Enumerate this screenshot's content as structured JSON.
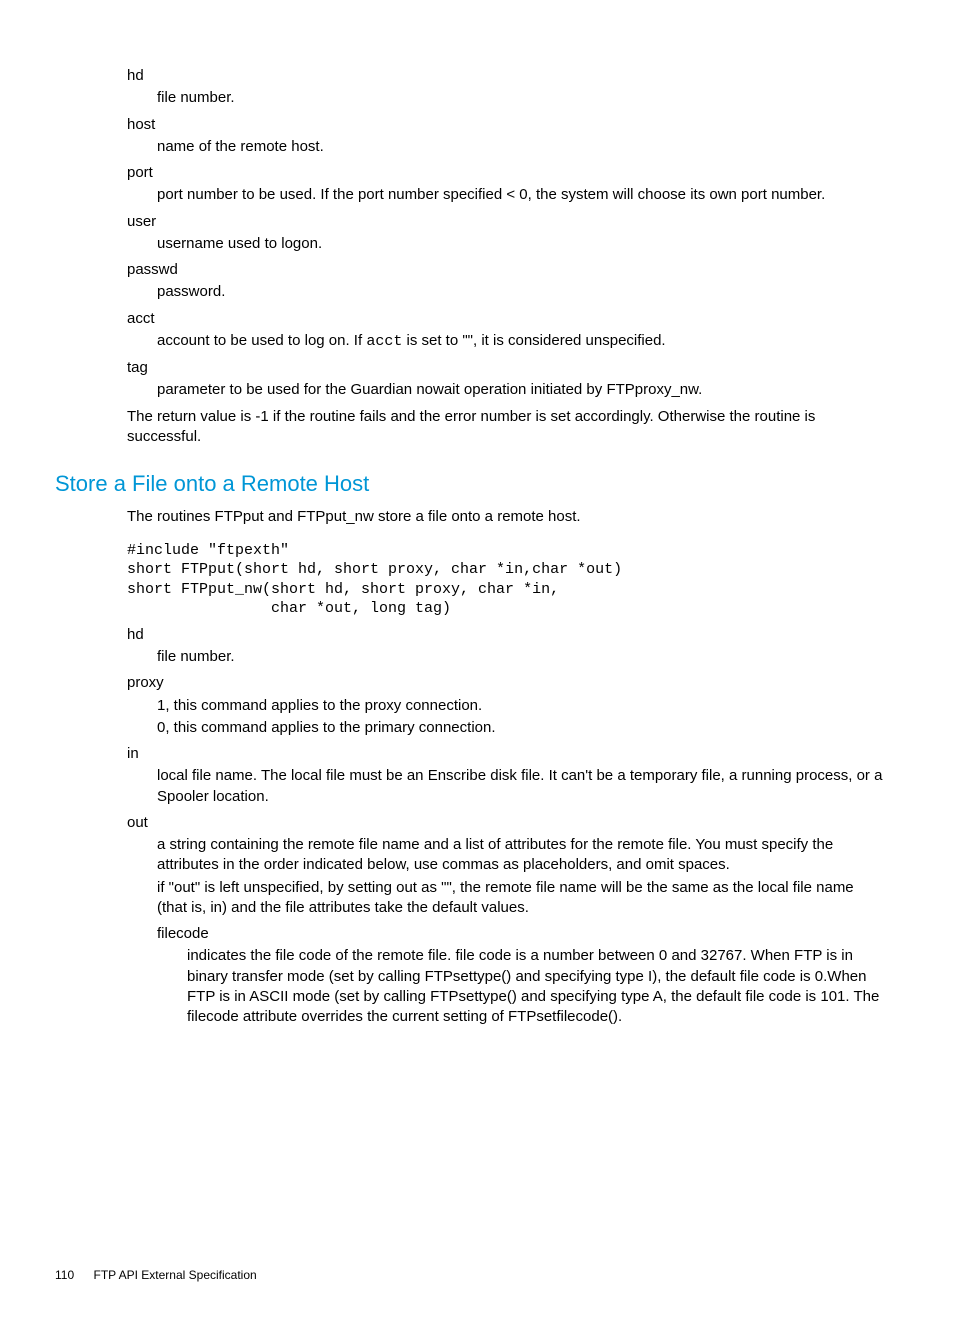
{
  "defs1": {
    "hd_t": "hd",
    "hd_d": "file number.",
    "host_t": "host",
    "host_d": "name of the remote host.",
    "port_t": "port",
    "port_d": "port number to be used. If the port number specified < 0, the system will choose its own port number.",
    "user_t": "user",
    "user_d": "username used to logon.",
    "passwd_t": "passwd",
    "passwd_d": "password.",
    "acct_t": "acct",
    "acct_d_pre": "account to be used to log on. If ",
    "acct_d_code": "acct",
    "acct_d_post": " is set to \"\", it is considered unspecified.",
    "tag_t": "tag",
    "tag_d": "parameter to be used for the Guardian nowait operation initiated by FTPproxy_nw.",
    "ret": "The return value is -1 if the routine fails and the error number is set accordingly. Otherwise the routine is successful."
  },
  "section": {
    "title": "Store a File onto a Remote Host",
    "intro": "The routines FTPput and FTPput_nw store a file onto a remote host.",
    "code": "#include \"ftpexth\"\nshort FTPput(short hd, short proxy, char *in,char *out)\nshort FTPput_nw(short hd, short proxy, char *in,\n                char *out, long tag)"
  },
  "defs2": {
    "hd_t": "hd",
    "hd_d": "file number.",
    "proxy_t": "proxy",
    "proxy_d1": "1, this command applies to the proxy connection.",
    "proxy_d2": "0, this command applies to the primary connection.",
    "in_t": "in",
    "in_d": "local file name. The local file must be an Enscribe disk file. It can't be a temporary file, a running process, or a Spooler location.",
    "out_t": "out",
    "out_d1": "a string containing the remote file name and a list of attributes for the remote file. You must specify the attributes in the order indicated below, use commas as placeholders, and omit spaces.",
    "out_d2": "if \"out\" is left unspecified, by setting out as \"\", the remote file name will be the same as the local file name (that is, in) and the file attributes take the default values.",
    "filecode_t": "filecode",
    "filecode_d": "indicates the file code of the remote file. file code is a number between 0 and 32767. When FTP is in binary transfer mode (set by calling FTPsettype() and specifying type I), the default file code is 0.When FTP is in ASCII mode (set by calling FTPsettype() and specifying type A, the default file code is 101. The filecode attribute overrides the current setting of FTPsetfilecode()."
  },
  "footer": {
    "page": "110",
    "chapter": "FTP API External Specification"
  }
}
